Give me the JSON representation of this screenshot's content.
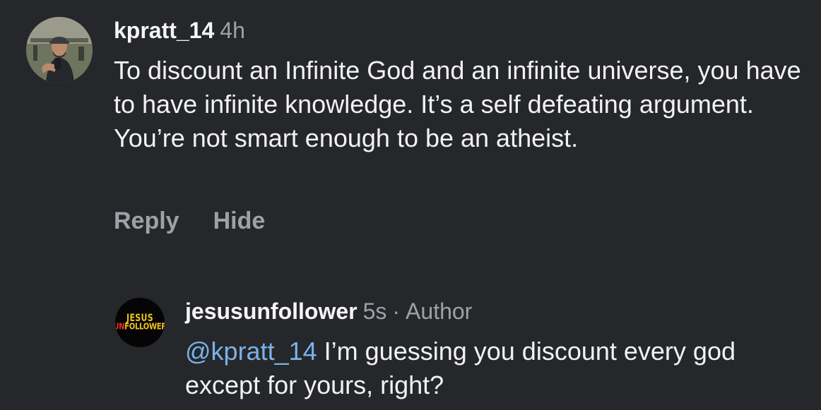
{
  "comments": [
    {
      "username": "kpratt_14",
      "time": "4h",
      "text": "To discount an Infinite God and an infinite universe, you have to have infinite knowledge. It’s a self defeating argument. You’re not smart enough to be an atheist.",
      "actions": {
        "reply": "Reply",
        "hide": "Hide"
      }
    }
  ],
  "reply": {
    "username": "jesusunfollower",
    "time": "5s",
    "separator": "·",
    "role": "Author",
    "mention": "@kpratt_14",
    "text": " I’m guessing you discount every god except for yours, right?",
    "avatar_logo": {
      "line1": "JESUS",
      "line2_a": "UN",
      "line2_b": "FOLLOWER"
    }
  },
  "colors": {
    "background": "#25272b",
    "text": "#f2f2f2",
    "muted": "#9ea1a6",
    "mention": "#7ab2e8",
    "logo_yellow": "#f0c419",
    "logo_red": "#e2342f"
  }
}
